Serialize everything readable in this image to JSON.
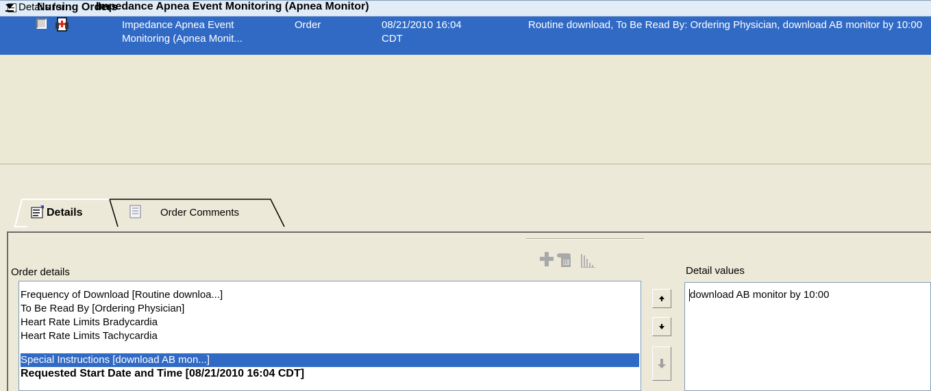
{
  "group": {
    "title": "Nursing Orders"
  },
  "selected_order": {
    "name_line1": "Impedance Apnea Event",
    "name_line2": "Monitoring (Apnea Monit...",
    "type": "Order",
    "date_line1": "08/21/2010 16:04",
    "date_line2": "CDT",
    "details": "Routine download, To Be Read By: Ordering Physician, download AB monitor by 10:00"
  },
  "details_header": {
    "prefix": "Details for",
    "title": "Impedance Apnea Event Monitoring (Apnea Monitor)"
  },
  "tabs": [
    {
      "label": "Details",
      "active": true
    },
    {
      "label": "Order Comments",
      "active": false
    }
  ],
  "order_details": {
    "label": "Order details",
    "items": [
      {
        "text": "Frequency of Download   [Routine downloa...]",
        "selected": false,
        "bold": false
      },
      {
        "text": "To Be Read By   [Ordering Physician]",
        "selected": false,
        "bold": false
      },
      {
        "text": "Heart Rate Limits Bradycardia",
        "selected": false,
        "bold": false
      },
      {
        "text": "Heart Rate Limits Tachycardia",
        "selected": false,
        "bold": false
      },
      {
        "text": "Special Instructions   [download AB mon...]",
        "selected": true,
        "bold": false
      },
      {
        "text": "Requested Start Date and Time    [08/21/2010 16:04 CDT]",
        "selected": false,
        "bold": true
      }
    ]
  },
  "detail_values": {
    "label": "Detail values",
    "value": "download AB monitor by 10:00"
  },
  "icons": {
    "order": "order-document-icon",
    "add": "add-icon",
    "phone": "phone-icon",
    "chart": "bar-chart-icon"
  }
}
